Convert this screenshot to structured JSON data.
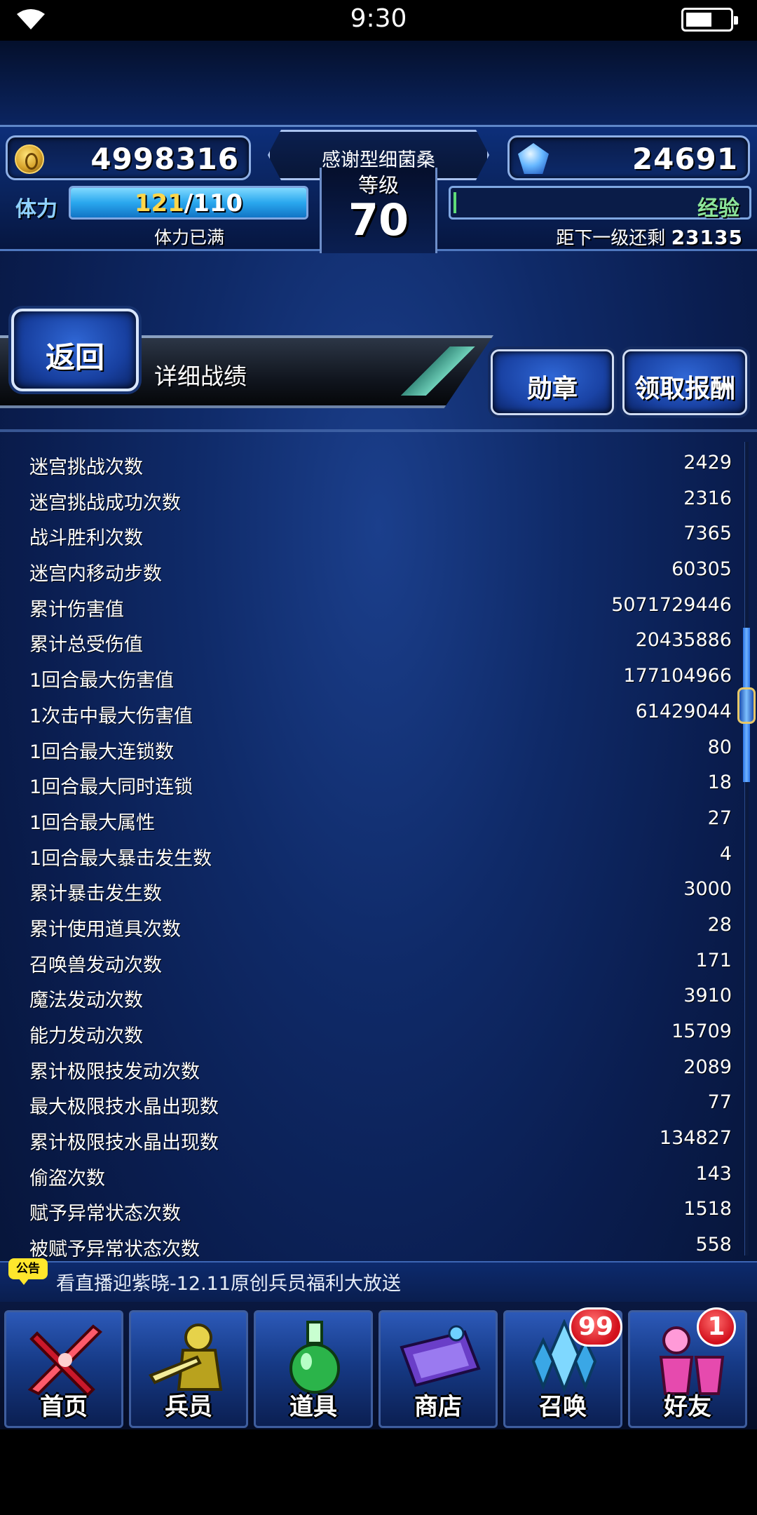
{
  "status_bar": {
    "time": "9:30"
  },
  "header": {
    "gil": "4998316",
    "gems": "24691",
    "player_name": "感谢型细菌桑",
    "level_label": "等级",
    "level": "70",
    "stamina_label": "体力",
    "stamina_current": "121",
    "stamina_max": "/110",
    "stamina_status": "体力已满",
    "exp_label": "经验",
    "exp_remaining_label": "距下一级还剩",
    "exp_remaining_value": "23135",
    "colors": {
      "stamina_fill": "#2aa7ee",
      "exp_fill": "#5edc78",
      "gold": "#ffd64a"
    }
  },
  "toolbar": {
    "back_label": "返回",
    "title": "详细战绩",
    "medal_label": "勋章",
    "reward_label": "领取报酬"
  },
  "stats": [
    {
      "label": "迷宫挑战次数",
      "value": "2429"
    },
    {
      "label": "迷宫挑战成功次数",
      "value": "2316"
    },
    {
      "label": "战斗胜利次数",
      "value": "7365"
    },
    {
      "label": "迷宫内移动步数",
      "value": "60305"
    },
    {
      "label": "累计伤害值",
      "value": "5071729446"
    },
    {
      "label": "累计总受伤值",
      "value": "20435886"
    },
    {
      "label": "1回合最大伤害值",
      "value": "177104966"
    },
    {
      "label": "1次击中最大伤害值",
      "value": "61429044"
    },
    {
      "label": "1回合最大连锁数",
      "value": "80"
    },
    {
      "label": "1回合最大同时连锁",
      "value": "18"
    },
    {
      "label": "1回合最大属性",
      "value": "27"
    },
    {
      "label": "1回合最大暴击发生数",
      "value": "4"
    },
    {
      "label": "累计暴击发生数",
      "value": "3000"
    },
    {
      "label": "累计使用道具次数",
      "value": "28"
    },
    {
      "label": "召唤兽发动次数",
      "value": "171"
    },
    {
      "label": "魔法发动次数",
      "value": "3910"
    },
    {
      "label": "能力发动次数",
      "value": "15709"
    },
    {
      "label": "累计极限技发动次数",
      "value": "2089"
    },
    {
      "label": "最大极限技水晶出现数",
      "value": "77"
    },
    {
      "label": "累计极限技水晶出现数",
      "value": "134827"
    },
    {
      "label": "偷盗次数",
      "value": "143"
    },
    {
      "label": "赋予异常状态次数",
      "value": "1518"
    },
    {
      "label": "被赋予异常状态次数",
      "value": "558"
    }
  ],
  "notice": {
    "tag": "公告",
    "text": "看直播迎紫晓-12.11原创兵员福利大放送"
  },
  "nav": [
    {
      "label": "首页",
      "icon": "sword-icon"
    },
    {
      "label": "兵员",
      "icon": "hero-icon"
    },
    {
      "label": "道具",
      "icon": "potion-icon"
    },
    {
      "label": "商店",
      "icon": "shop-icon"
    },
    {
      "label": "召唤",
      "icon": "crystal-icon",
      "badge": "99"
    },
    {
      "label": "好友",
      "icon": "friends-icon",
      "badge": "1"
    }
  ]
}
